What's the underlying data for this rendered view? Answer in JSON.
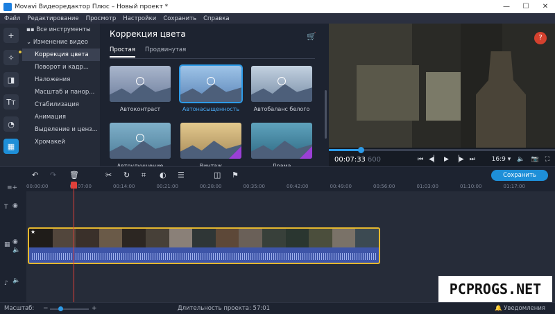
{
  "window": {
    "title": "Movavi Видеоредактор Плюс – Новый проект *",
    "controls": [
      "—",
      "☐",
      "✕"
    ]
  },
  "menu": [
    "Файл",
    "Редактирование",
    "Просмотр",
    "Настройки",
    "Сохранить",
    "Справка"
  ],
  "tools": [
    {
      "name": "import-tool",
      "icon": "+"
    },
    {
      "name": "magic-tool",
      "icon": "✧"
    },
    {
      "name": "transitions-tool",
      "icon": "◨"
    },
    {
      "name": "titles-tool",
      "icon": "Tт"
    },
    {
      "name": "filters-tool",
      "icon": "◔"
    },
    {
      "name": "more-tools",
      "icon": "▦"
    }
  ],
  "sidebar": {
    "all_tools": "Все инструменты",
    "section": "Изменение видео",
    "items": [
      "Коррекция цвета",
      "Поворот и кадр...",
      "Наложения",
      "Масштаб и панор...",
      "Стабилизация",
      "Анимация",
      "Выделение и ценз...",
      "Хромакей"
    ]
  },
  "effects": {
    "title": "Коррекция цвета",
    "tabs": [
      "Простая",
      "Продвинутая"
    ],
    "tiles": [
      {
        "label": "Автоконтраст",
        "color": "#6f7f9e",
        "sky": "#a9b6cc"
      },
      {
        "label": "Автонасыщенность",
        "color": "#5d86b8",
        "sky": "#9ec4e8"
      },
      {
        "label": "Автобаланс белого",
        "color": "#7a8fa8",
        "sky": "#c3d1e0"
      },
      {
        "label": "Автоулучшение",
        "color": "#4f7f9b",
        "sky": "#7fb0c9"
      },
      {
        "label": "Винтаж",
        "color": "#a88b5a",
        "sky": "#e3c98d"
      },
      {
        "label": "Драма",
        "color": "#2f6a84",
        "sky": "#5fa3bd"
      }
    ],
    "new_badge": "NEW"
  },
  "preview": {
    "help": "?",
    "progress_fraction": 0.14,
    "time": "00:07:33",
    "frames": "600",
    "aspect": "16:9 ▾",
    "icons": [
      "⏮",
      "◀▏",
      "▶",
      "▕▶",
      "⏭"
    ],
    "right_icons": [
      "🔈",
      "📷",
      "⛶"
    ]
  },
  "toolbar": {
    "save_label": "Сохранить"
  },
  "ruler": [
    "00:00:00",
    "00:07:00",
    "00:14:00",
    "00:21:00",
    "00:28:00",
    "00:35:00",
    "00:42:00",
    "00:49:00",
    "00:56:00",
    "01:03:00",
    "01:10:00",
    "01:17:00"
  ],
  "clip_colors": [
    "#1f1c19",
    "#52463c",
    "#3a302a",
    "#6a5a48",
    "#2c2622",
    "#474038",
    "#8a8078",
    "#2f3636",
    "#5d4838",
    "#6a6058",
    "#38403a",
    "#2a3630",
    "#4b4e3c",
    "#7a7268",
    "#3c4a52"
  ],
  "status": {
    "zoom_label": "Масштаб:",
    "duration": "Длительность проекта: 57:01",
    "notifications": "🔔 Уведомления"
  },
  "watermark": "PCPROGS.NET"
}
